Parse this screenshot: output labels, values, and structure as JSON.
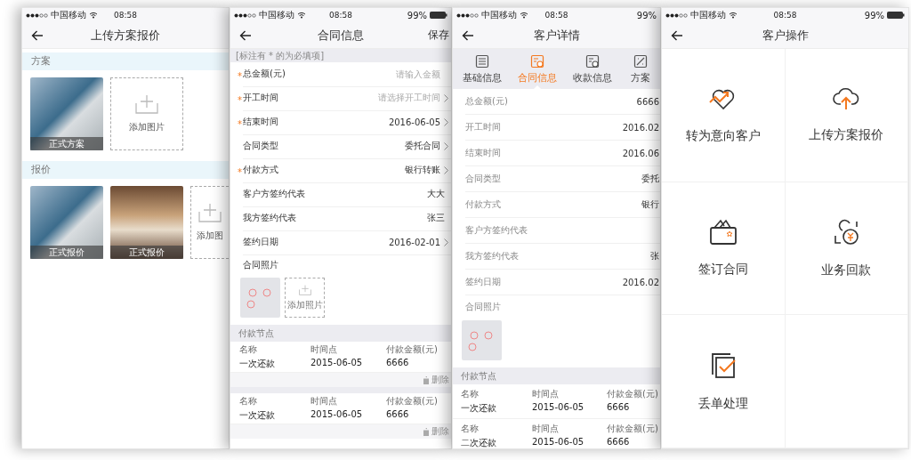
{
  "screens": [
    {
      "kind": "upload",
      "status": {
        "carrier": "中国移动",
        "time": "08:58"
      },
      "title": "上传方案报价",
      "sections": [
        {
          "heading": "方案",
          "photos": [
            {
              "caption": "正式方案"
            }
          ],
          "add_label": "添加图片"
        },
        {
          "heading": "报价",
          "photos": [
            {
              "caption": "正式报价"
            },
            {
              "caption": "正式报价"
            }
          ],
          "add_label": "添加图"
        }
      ]
    },
    {
      "kind": "form",
      "status": {
        "carrier": "中国移动",
        "time": "08:58",
        "battery": "99%"
      },
      "title": "合同信息",
      "action": "保存",
      "note": "[标注有 * 的为必填项]",
      "fields": [
        {
          "label": "总金额(元)",
          "mark": "*",
          "kind": "input",
          "placeholder": "请输入金额"
        },
        {
          "label": "开工时间",
          "mark": "*",
          "kind": "select",
          "placeholder": "请选择开工时间"
        },
        {
          "label": "结束时间",
          "mark": "*",
          "kind": "select",
          "value": "2016-06-05"
        },
        {
          "label": "合同类型",
          "kind": "select",
          "value": "委托合同"
        },
        {
          "label": "付款方式",
          "mark": "*",
          "kind": "select",
          "value": "银行转账"
        },
        {
          "label": "客户方签约代表",
          "kind": "text",
          "value": "大大"
        },
        {
          "label": "我方签约代表",
          "kind": "text",
          "value": "张三"
        },
        {
          "label": "签约日期",
          "kind": "select",
          "value": "2016-02-01"
        }
      ],
      "photo_label": "合同照片",
      "add_label": "添加照片",
      "nodes_heading": "付款节点",
      "nodes": [
        {
          "columns": [
            {
              "label": "名称",
              "value": "一次还款"
            },
            {
              "label": "时间点",
              "value": "2015-06-05"
            },
            {
              "label": "付款金额(元)",
              "value": "6666"
            }
          ],
          "delete": "删除"
        },
        {
          "columns": [
            {
              "label": "名称",
              "value": "一次还款"
            },
            {
              "label": "时间点",
              "value": "2015-06-05"
            },
            {
              "label": "付款金额(元)",
              "value": "6666"
            }
          ],
          "delete": "删除"
        }
      ]
    },
    {
      "kind": "detail",
      "status": {
        "carrier": "中国移动",
        "time": "08:58",
        "battery": "99%"
      },
      "title": "客户详情",
      "tabs": [
        {
          "label": "基础信息",
          "selected": false
        },
        {
          "label": "合同信息",
          "selected": true
        },
        {
          "label": "收款信息",
          "selected": false
        },
        {
          "label": "方案",
          "selected": false
        }
      ],
      "fields": [
        {
          "label": "总金额(元)",
          "value": "6666"
        },
        {
          "label": "开工时间",
          "value": "2016.02"
        },
        {
          "label": "结束时间",
          "value": "2016.06"
        },
        {
          "label": "合同类型",
          "value": "委托"
        },
        {
          "label": "付款方式",
          "value": "银行"
        },
        {
          "label": "客户方签约代表"
        },
        {
          "label": "我方签约代表",
          "value": "张"
        },
        {
          "label": "签约日期",
          "value": "2016.02"
        }
      ],
      "photo_label": "合同照片",
      "nodes_heading": "付款节点",
      "nodes": [
        {
          "columns": [
            {
              "label": "名称",
              "value": "一次还款"
            },
            {
              "label": "时间点",
              "value": "2015-06-05"
            },
            {
              "label": "付款金额(元)",
              "value": "6666"
            }
          ]
        },
        {
          "columns": [
            {
              "label": "名称",
              "value": "二次还款"
            },
            {
              "label": "时间点",
              "value": "2015-06-05"
            },
            {
              "label": "付款金额(元)",
              "value": "6666"
            }
          ]
        }
      ]
    },
    {
      "kind": "actions",
      "status": {
        "carrier": "中国移动",
        "time": "08:58",
        "battery": "99%"
      },
      "title": "客户操作",
      "actions": [
        {
          "label": "转为意向客户"
        },
        {
          "label": "上传方案报价"
        },
        {
          "label": "签订合同"
        },
        {
          "label": "业务回款"
        },
        {
          "label": "丢单处理"
        }
      ]
    }
  ]
}
